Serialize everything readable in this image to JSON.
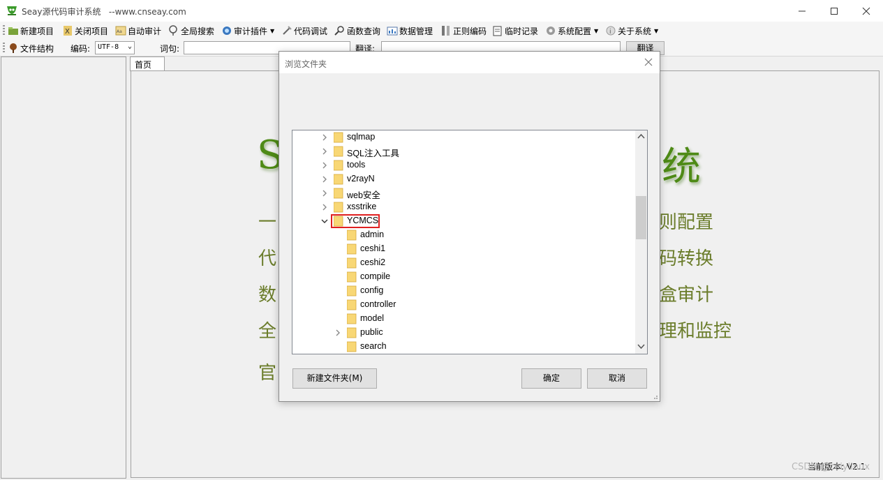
{
  "window": {
    "title": "Seay源代码审计系统",
    "url": "--www.cnseay.com"
  },
  "toolbar": {
    "items": [
      {
        "label": "新建项目"
      },
      {
        "label": "关闭项目"
      },
      {
        "label": "自动审计"
      },
      {
        "label": "全局搜索"
      },
      {
        "label": "审计插件"
      },
      {
        "label": "代码调试"
      },
      {
        "label": "函数查询"
      },
      {
        "label": "数据管理"
      },
      {
        "label": "正则编码"
      },
      {
        "label": "临时记录"
      },
      {
        "label": "系统配置"
      },
      {
        "label": "关于系统"
      }
    ]
  },
  "toolbar2": {
    "file_structure": "文件结构",
    "encoding_label": "编码:",
    "encoding_value": "UTF-8",
    "word_label": "词句:",
    "word_value": "",
    "translate_label": "翻译:",
    "translate_value": "",
    "translate_button": "翻译"
  },
  "tabs": {
    "home": "首页"
  },
  "main": {
    "title_left": "S",
    "title_right": "统",
    "features_left": [
      "一",
      "代",
      "数",
      "全",
      "官"
    ],
    "features_right": [
      "则配置",
      "码转换",
      "盒审计",
      "理和监控"
    ]
  },
  "status": {
    "version": "当前版本: V2.1"
  },
  "watermark": "CSDN @ceiylinux",
  "dialog": {
    "title": "浏览文件夹",
    "tree": [
      {
        "label": "sqlmap",
        "level": 0,
        "expander": "collapsed"
      },
      {
        "label": "SQL注入工具",
        "level": 0,
        "expander": "collapsed"
      },
      {
        "label": "tools",
        "level": 0,
        "expander": "collapsed"
      },
      {
        "label": "v2rayN",
        "level": 0,
        "expander": "collapsed"
      },
      {
        "label": "web安全",
        "level": 0,
        "expander": "collapsed"
      },
      {
        "label": "xsstrike",
        "level": 0,
        "expander": "collapsed"
      },
      {
        "label": "YCMCS",
        "level": 0,
        "expander": "expanded",
        "selected": true
      },
      {
        "label": "admin",
        "level": 1,
        "expander": "none"
      },
      {
        "label": "ceshi1",
        "level": 1,
        "expander": "none"
      },
      {
        "label": "ceshi2",
        "level": 1,
        "expander": "none"
      },
      {
        "label": "compile",
        "level": 1,
        "expander": "none"
      },
      {
        "label": "config",
        "level": 1,
        "expander": "none"
      },
      {
        "label": "controller",
        "level": 1,
        "expander": "none"
      },
      {
        "label": "model",
        "level": 1,
        "expander": "none"
      },
      {
        "label": "public",
        "level": 1,
        "expander": "collapsed"
      },
      {
        "label": "search",
        "level": 1,
        "expander": "none"
      }
    ],
    "new_folder_button": "新建文件夹(M)",
    "ok_button": "确定",
    "cancel_button": "取消"
  },
  "colors": {
    "title_green": "#4e8a16",
    "feature_text": "#6b7d2b",
    "selection_border": "#e02020",
    "folder_yellow": "#f8d775"
  }
}
